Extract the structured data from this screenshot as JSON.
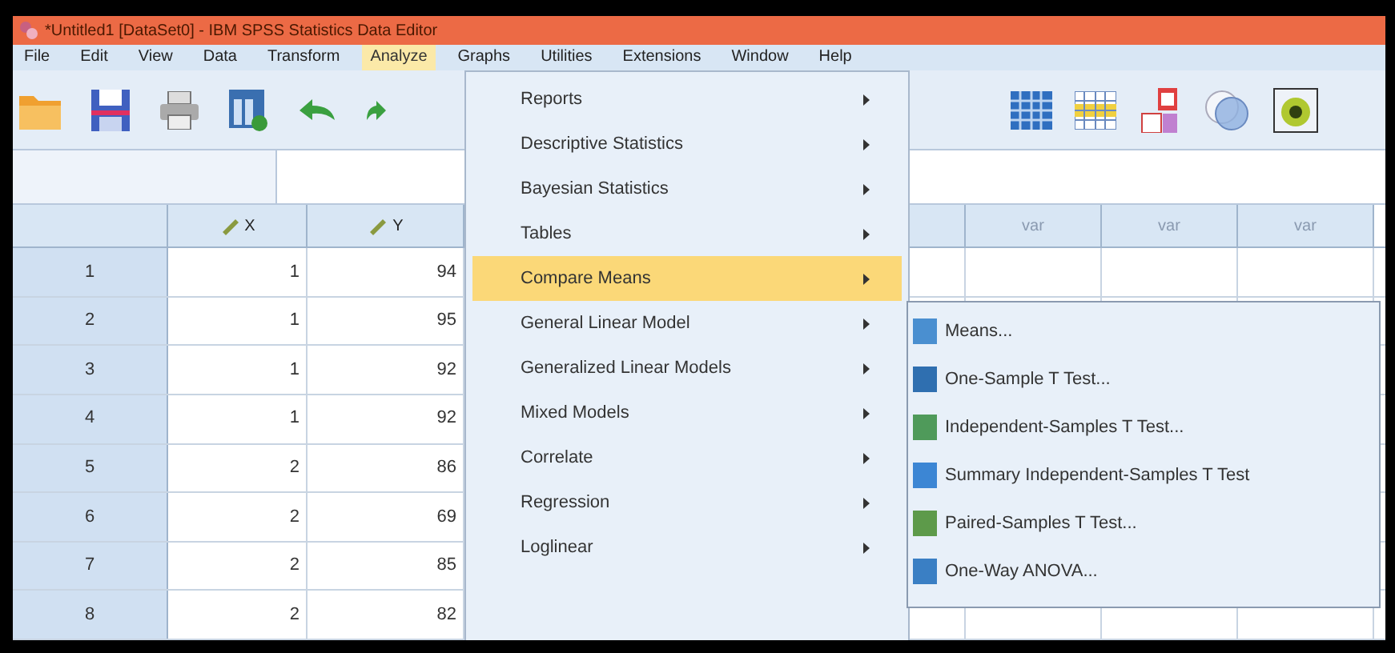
{
  "window": {
    "title": "*Untitled1 [DataSet0] - IBM SPSS Statistics Data Editor"
  },
  "menu_bar": [
    {
      "label": "File",
      "selected": false
    },
    {
      "label": "Edit",
      "selected": false
    },
    {
      "label": "View",
      "selected": false
    },
    {
      "label": "Data",
      "selected": false
    },
    {
      "label": "Transform",
      "selected": false
    },
    {
      "label": "Analyze",
      "selected": true
    },
    {
      "label": "Graphs",
      "selected": false
    },
    {
      "label": "Utilities",
      "selected": false
    },
    {
      "label": "Extensions",
      "selected": false
    },
    {
      "label": "Window",
      "selected": false
    },
    {
      "label": "Help",
      "selected": false
    }
  ],
  "grid": {
    "columns": [
      {
        "label": "X",
        "kind": "variable"
      },
      {
        "label": "Y",
        "kind": "variable"
      },
      {
        "label": "var",
        "kind": "empty"
      },
      {
        "label": "var",
        "kind": "empty"
      },
      {
        "label": "var",
        "kind": "empty"
      }
    ],
    "rows": [
      {
        "number": "1",
        "values": [
          "1",
          "94"
        ]
      },
      {
        "number": "2",
        "values": [
          "1",
          "95"
        ]
      },
      {
        "number": "3",
        "values": [
          "1",
          "92"
        ]
      },
      {
        "number": "4",
        "values": [
          "1",
          "92"
        ]
      },
      {
        "number": "5",
        "values": [
          "2",
          "86"
        ]
      },
      {
        "number": "6",
        "values": [
          "2",
          "69"
        ]
      },
      {
        "number": "7",
        "values": [
          "2",
          "85"
        ]
      },
      {
        "number": "8",
        "values": [
          "2",
          "82"
        ]
      }
    ]
  },
  "analyze_menu": [
    {
      "label": "Reports",
      "selected": false
    },
    {
      "label": "Descriptive Statistics",
      "selected": false
    },
    {
      "label": "Bayesian Statistics",
      "selected": false
    },
    {
      "label": "Tables",
      "selected": false
    },
    {
      "label": "Compare Means",
      "selected": true
    },
    {
      "label": "General Linear Model",
      "selected": false
    },
    {
      "label": "Generalized Linear Models",
      "selected": false
    },
    {
      "label": "Mixed Models",
      "selected": false
    },
    {
      "label": "Correlate",
      "selected": false
    },
    {
      "label": "Regression",
      "selected": false
    },
    {
      "label": "Loglinear",
      "selected": false
    }
  ],
  "compare_means_menu": [
    {
      "label": "Means...",
      "color": "#4a8fd0"
    },
    {
      "label": "One-Sample T Test...",
      "color": "#2f6fb0"
    },
    {
      "label": "Independent-Samples T Test...",
      "color": "#4f9a5a"
    },
    {
      "label": "Summary Independent-Samples T Test",
      "color": "#3c86d4"
    },
    {
      "label": "Paired-Samples T Test...",
      "color": "#5d9a4a"
    },
    {
      "label": "One-Way ANOVA...",
      "color": "#3a7fc4"
    }
  ]
}
